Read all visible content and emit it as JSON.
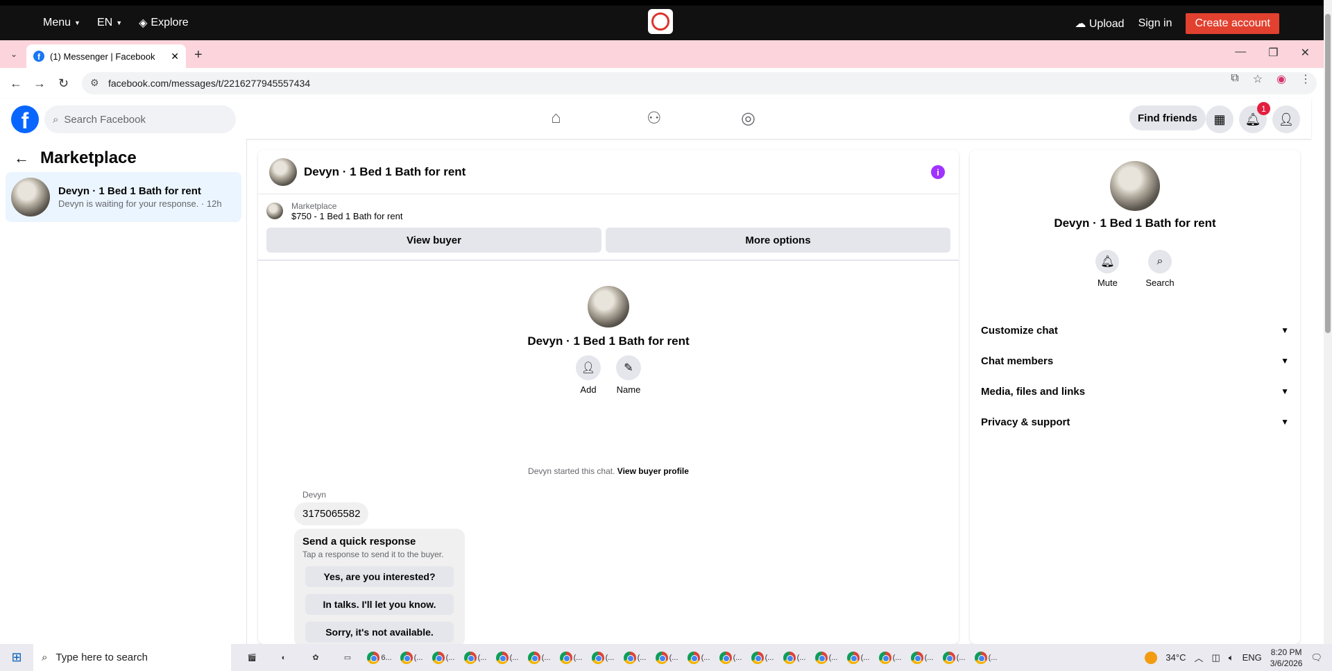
{
  "site_bar": {
    "menu": "Menu",
    "lang": "EN",
    "explore": "Explore",
    "upload": "Upload",
    "signin": "Sign in",
    "create": "Create account"
  },
  "browser": {
    "tab_title": "(1) Messenger | Facebook",
    "url": "facebook.com/messages/t/2216277945557434"
  },
  "fb_header": {
    "search_placeholder": "Search Facebook",
    "find_friends": "Find friends",
    "notif_count": "1"
  },
  "sidebar": {
    "title": "Marketplace",
    "conversation": {
      "name": "Devyn · 1 Bed 1 Bath for rent",
      "status": "Devyn is waiting for your response. · 12h"
    }
  },
  "chat": {
    "header_name": "Devyn · 1 Bed 1 Bath for rent",
    "listing_label": "Marketplace",
    "listing_price": "$750 - 1 Bed 1 Bath for rent",
    "view_buyer": "View buyer",
    "more_options": "More options",
    "center_name": "Devyn · 1 Bed 1 Bath for rent",
    "add_label": "Add",
    "name_label": "Name",
    "started_text": "Devyn started this chat.",
    "view_profile": "View buyer profile",
    "sender": "Devyn",
    "message": "3175065582",
    "quick_title": "Send a quick response",
    "quick_sub": "Tap a response to send it to the buyer.",
    "quick_options": [
      "Yes, are you interested?",
      "In talks. I'll let you know.",
      "Sorry, it's not available."
    ]
  },
  "info_panel": {
    "name": "Devyn · 1 Bed 1 Bath for rent",
    "mute": "Mute",
    "search": "Search",
    "sections": [
      "Customize chat",
      "Chat members",
      "Media, files and links",
      "Privacy & support"
    ]
  },
  "taskbar": {
    "search_placeholder": "Type here to search",
    "weather": "34°C",
    "lang": "ENG",
    "time": "8:20 PM",
    "date": "3/6/2026",
    "active_label": "6...",
    "app_label": "(..."
  }
}
